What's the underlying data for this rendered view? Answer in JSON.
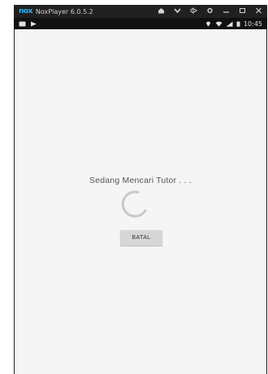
{
  "window": {
    "logo": "nox",
    "title": "NoxPlayer 6.0.5.2",
    "controls": [
      "home-icon",
      "chevron-down-icon",
      "keyboard-icon",
      "settings-icon",
      "minimize-icon",
      "maximize-icon",
      "close-icon"
    ]
  },
  "statusbar": {
    "time": "10:45",
    "left_icons": [
      "notification-icon",
      "play-store-icon"
    ],
    "right_icons": [
      "location-icon",
      "wifi-icon",
      "signal-icon",
      "battery-icon"
    ]
  },
  "dialog": {
    "message": "Sedang Mencari Tutor . . .",
    "cancel_label": "BATAL"
  },
  "colors": {
    "screen_bg": "#f5f5f5",
    "frame": "#202020",
    "accent_logo": "#29b6f6"
  }
}
